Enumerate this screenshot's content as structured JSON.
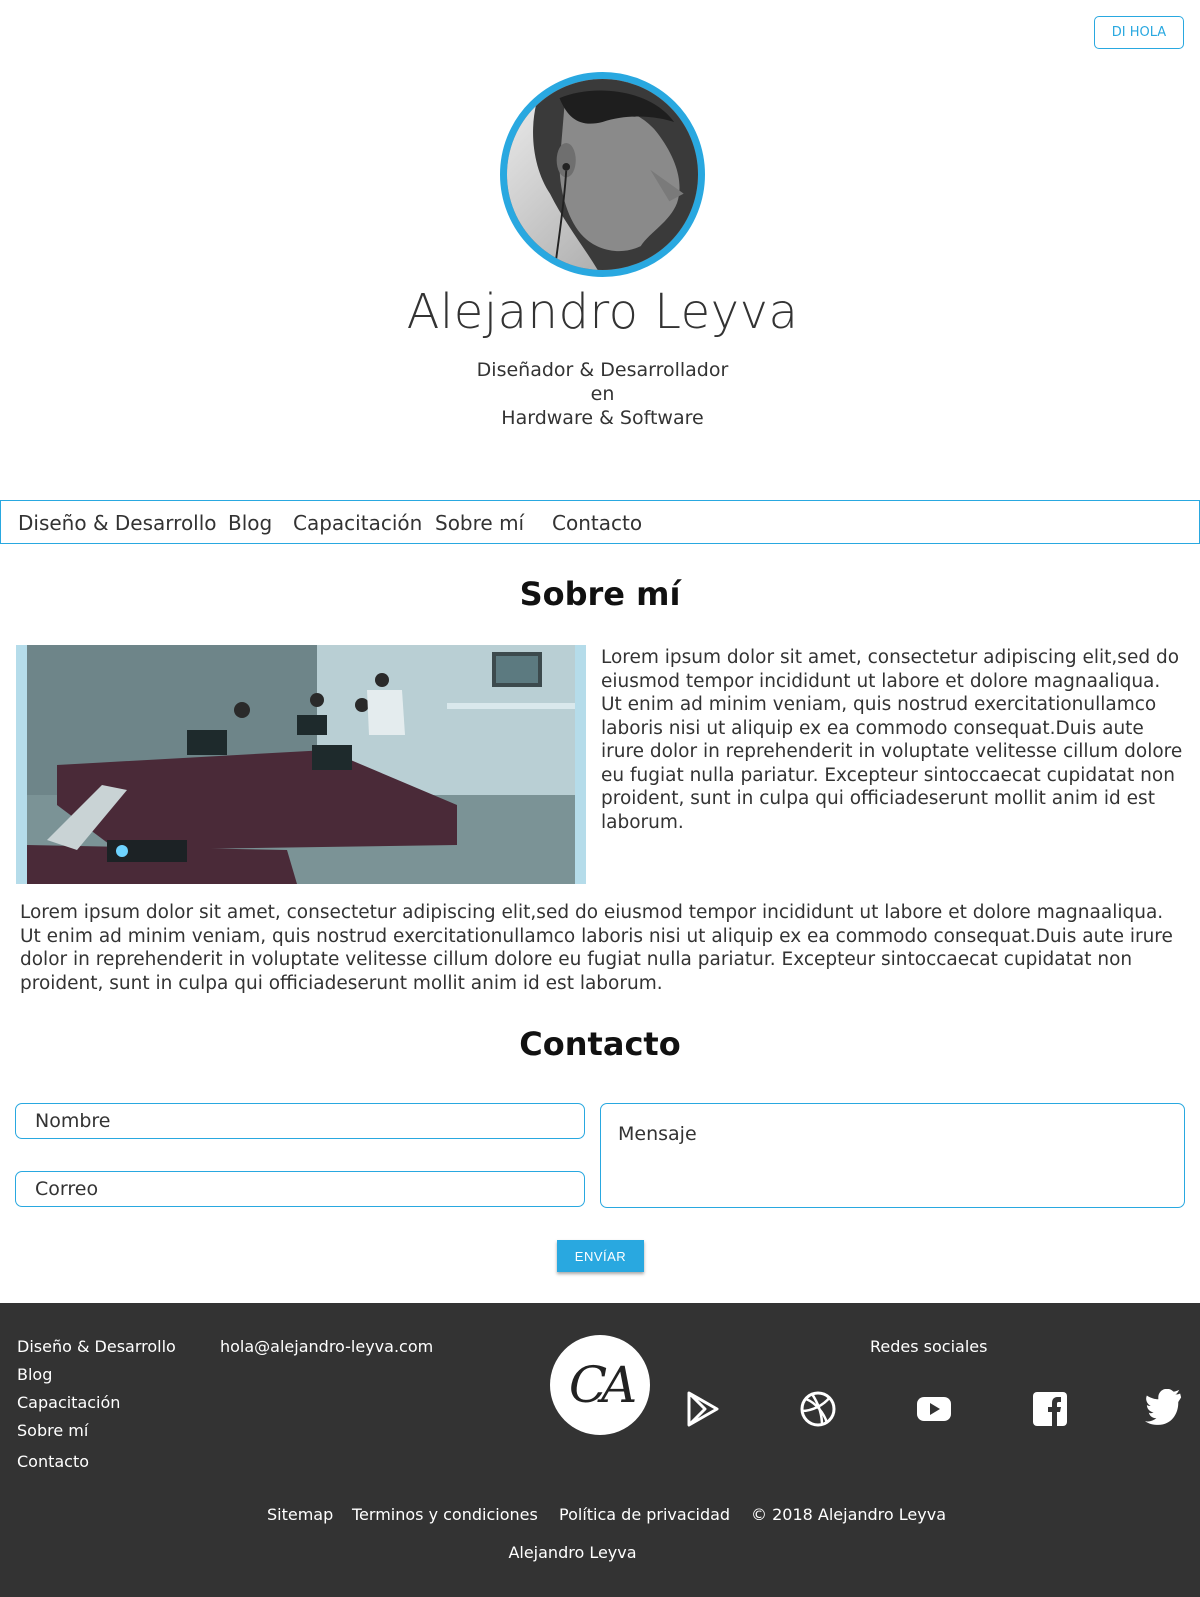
{
  "header": {
    "cta_label": "DI HOLA"
  },
  "profile": {
    "name": "Alejandro Leyva",
    "subtitle_line1": "Diseñador & Desarrollador",
    "subtitle_line2": "en",
    "subtitle_line3": "Hardware & Software"
  },
  "nav": {
    "items": [
      {
        "label": "Diseño & Desarrollo"
      },
      {
        "label": "Blog"
      },
      {
        "label": "Capacitación"
      },
      {
        "label": "Sobre mí"
      },
      {
        "label": "Contacto"
      }
    ]
  },
  "about": {
    "title": "Sobre mí",
    "paragraph1": "Lorem ipsum dolor sit amet, consectetur adipiscing elit,sed do eiusmod tempor incididunt ut labore et dolore magnaaliqua. Ut enim ad minim veniam, quis nostrud exercitationullamco laboris nisi ut aliquip ex ea commodo consequat.Duis aute irure dolor in reprehenderit in voluptate velitesse cillum dolore eu fugiat nulla pariatur. Excepteur sintoccaecat cupidatat non proident, sunt in culpa qui officiadeserunt mollit anim id est laborum.",
    "paragraph2": "Lorem ipsum dolor sit amet, consectetur adipiscing elit,sed do eiusmod tempor incididunt ut labore et dolore magnaaliqua. Ut enim ad minim veniam, quis nostrud exercitationullamco laboris nisi ut aliquip ex ea commodo consequat.Duis aute irure dolor in reprehenderit in voluptate velitesse cillum dolore eu fugiat nulla pariatur. Excepteur sintoccaecat cupidatat non proident, sunt in culpa qui officiadeserunt mollit anim id est laborum."
  },
  "contact": {
    "title": "Contacto",
    "name_placeholder": "Nombre",
    "email_placeholder": "Correo",
    "message_placeholder": "Mensaje",
    "send_label": "ENVÍAR"
  },
  "footer": {
    "links": [
      {
        "label": "Diseño & Desarrollo"
      },
      {
        "label": "Blog"
      },
      {
        "label": "Capacitación"
      },
      {
        "label": "Sobre mí"
      },
      {
        "label": "Contacto"
      }
    ],
    "email": "hola@alejandro-leyva.com",
    "logo_text": "CA",
    "social_title": "Redes sociales",
    "social_icons": [
      "google-play-icon",
      "dribbble-icon",
      "youtube-icon",
      "facebook-icon",
      "twitter-icon"
    ],
    "bottom_links": [
      {
        "label": "Sitemap"
      },
      {
        "label": "Terminos y condiciones"
      },
      {
        "label": "Política de privacidad"
      }
    ],
    "copyright": "© 2018 Alejandro Leyva",
    "author": "Alejandro Leyva"
  },
  "colors": {
    "accent": "#29a8e0",
    "footer_bg": "#333333",
    "text": "#333333"
  }
}
